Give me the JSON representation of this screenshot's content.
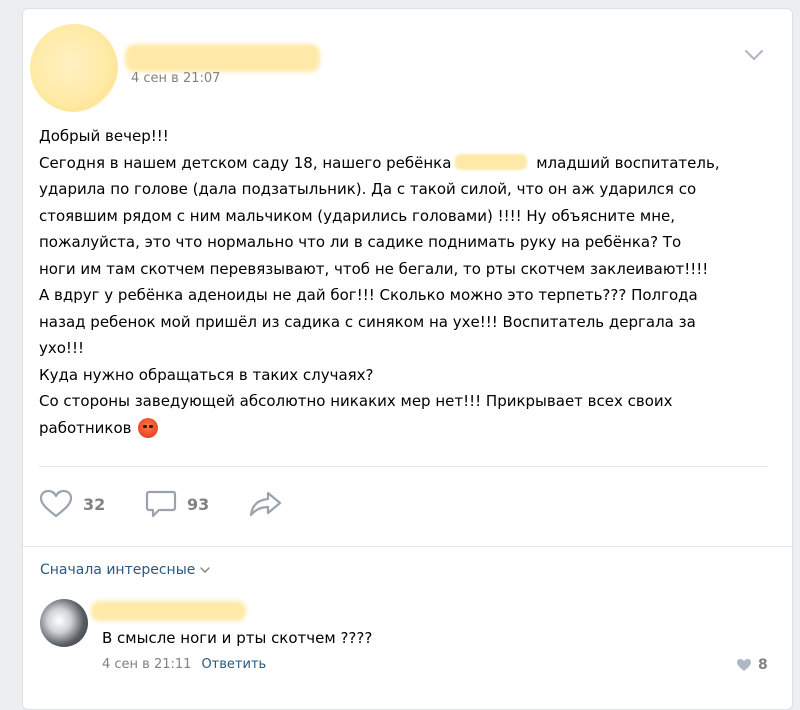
{
  "post": {
    "date": "4 сен в 21:07",
    "lines": [
      "Добрый вечер!!!",
      "Сегодня в нашем детском саду 18, нашего ребёнка",
      "младший воспитатель,",
      "ударила по голове (дала подзатыльник). Да с такой силой, что он аж ударился со",
      "стоявшим рядом с ним мальчиком (ударились головами) !!!! Ну объясните мне,",
      "пожалуйста, это что нормально что ли в садике поднимать руку на ребёнка? То",
      "ноги им там скотчем перевязывают, чтоб не бегали, то рты скотчем заклеивают!!!!",
      "А вдруг у ребёнка аденоиды не дай бог!!! Сколько можно это терпеть??? Полгода",
      "назад ребенок мой пришёл из садика с синяком на ухе!!! Воспитатель дергала за",
      "ухо!!!",
      "Куда нужно обращаться в таких случаях?",
      "Со стороны заведующей абсолютно никаких мер нет!!! Прикрывает всех своих",
      "работников"
    ]
  },
  "actions": {
    "likes": "32",
    "comments": "93"
  },
  "comments_section": {
    "sort_label": "Сначала интересные",
    "comment": {
      "text": "В смысле ноги и рты скотчем ????",
      "date": "4 сен в 21:11",
      "reply_label": "Ответить",
      "likes": "8"
    }
  },
  "colors": {
    "accent": "#2a5885",
    "muted": "#828282",
    "icon": "#99a2ad"
  }
}
